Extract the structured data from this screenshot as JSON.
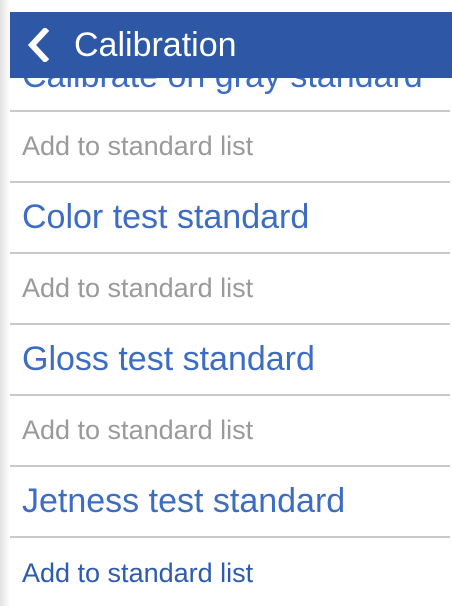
{
  "header": {
    "title": "Calibration",
    "back_icon": "chevron-left-icon"
  },
  "list": {
    "partial_item": "Calibrate on gray standard",
    "rows": [
      {
        "type": "action",
        "label": "Add to standard list"
      },
      {
        "type": "item",
        "label": "Color test standard"
      },
      {
        "type": "action",
        "label": "Add to standard list"
      },
      {
        "type": "item",
        "label": "Gloss test standard"
      },
      {
        "type": "action",
        "label": "Add to standard list"
      },
      {
        "type": "item",
        "label": "Jetness test standard"
      },
      {
        "type": "action",
        "label": "Add to standard list"
      }
    ]
  },
  "colors": {
    "header_bg": "#2e58a6",
    "item_text": "#3d6cc4",
    "action_text": "#9a9a9a",
    "divider": "#c9c9c9"
  }
}
